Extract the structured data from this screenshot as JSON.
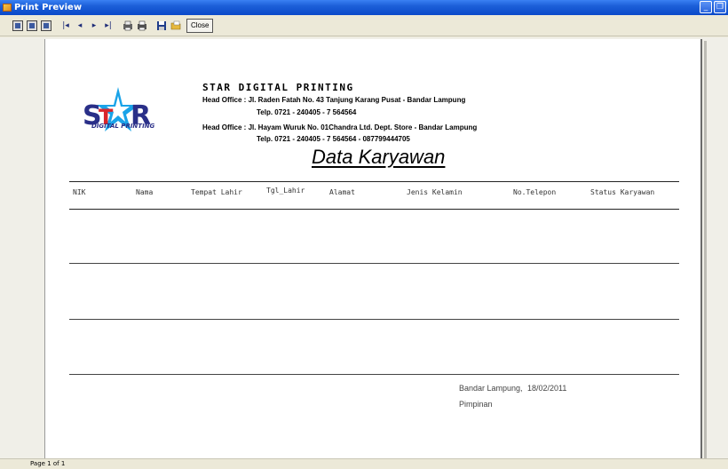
{
  "window": {
    "title": "Print Preview",
    "minimize_glyph": "_",
    "restore_glyph": "❐"
  },
  "toolbar": {
    "nav_first": "|◂",
    "nav_prev": "◂",
    "nav_next": "▸",
    "nav_last": "▸|",
    "close_label": "Close"
  },
  "report": {
    "company": "STAR DIGITAL PRINTING",
    "logo_text": "DIGITAL PRINTING",
    "address1": "Head Office : Jl. Raden Fatah No. 43 Tanjung Karang Pusat - Bandar Lampung",
    "phone1": "Telp. 0721 - 240405 - 7 564564",
    "address2": "Head Office : Jl. Hayam Wuruk No. 01Chandra Ltd. Dept. Store - Bandar Lampung",
    "phone2": "Telp. 0721 - 240405 - 7 564564 - 087799444705",
    "title": "Data Karyawan",
    "columns": [
      "NIK",
      "Nama",
      "Tempat Lahir",
      "Tgl_Lahir",
      "Alamat",
      "Jenis Kelamin",
      "No.Telepon",
      "Status Karyawan"
    ],
    "place": "Bandar Lampung,",
    "date": "18/02/2011",
    "signer": "Pimpinan"
  },
  "status": {
    "page": "Page 1 of 1"
  },
  "colors": {
    "titlebar": "#0a49c9",
    "logo_blue": "#2a2f88",
    "logo_star": "#1aa3e8",
    "logo_red": "#d8262c"
  }
}
